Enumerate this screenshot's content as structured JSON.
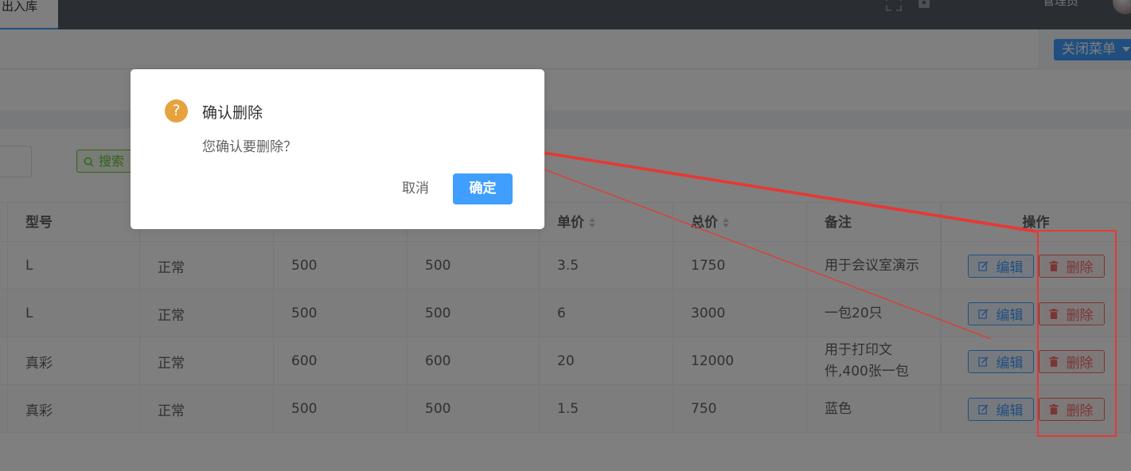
{
  "topbar": {
    "active_tab": "出入库",
    "user_name": "管理员"
  },
  "tagbar": {
    "close_menu_label": "关闭菜单"
  },
  "search": {
    "button_label": "搜索"
  },
  "table": {
    "headers": {
      "model": "型号",
      "unit_price": "单价",
      "total_price": "总价",
      "note": "备注",
      "ops": "操作"
    },
    "rows": [
      {
        "model": "L",
        "status": "正常",
        "c3": "500",
        "c4": "500",
        "unit_price": "3.5",
        "total_price": "1750",
        "note": "用于会议室演示"
      },
      {
        "model": "L",
        "status": "正常",
        "c3": "500",
        "c4": "500",
        "unit_price": "6",
        "total_price": "3000",
        "note": "一包20只"
      },
      {
        "model": "真彩",
        "status": "正常",
        "c3": "600",
        "c4": "600",
        "unit_price": "20",
        "total_price": "12000",
        "note": "用于打印文件,400张一包"
      },
      {
        "model": "真彩",
        "status": "正常",
        "c3": "500",
        "c4": "500",
        "unit_price": "1.5",
        "total_price": "750",
        "note": "蓝色"
      }
    ],
    "edit_label": "编辑",
    "delete_label": "删除"
  },
  "dialog": {
    "icon": "?",
    "title": "确认删除",
    "message": "您确认要删除？",
    "cancel_label": "取消",
    "confirm_label": "确定"
  },
  "colors": {
    "primary": "#409eff",
    "danger": "#f56c6c",
    "success": "#67c23a",
    "warning": "#e6a23c",
    "annotation_red": "#e53935"
  }
}
